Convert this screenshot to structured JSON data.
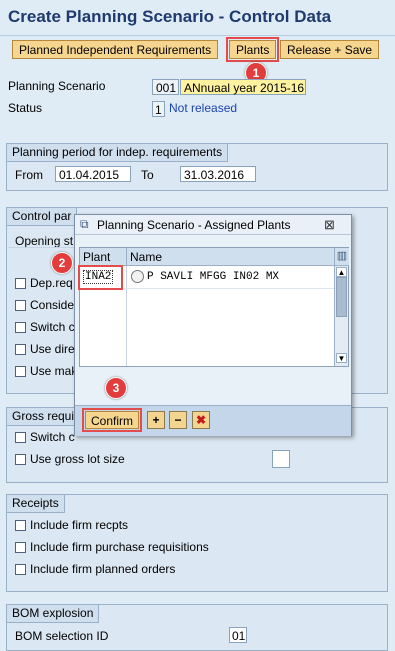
{
  "page": {
    "title": "Create Planning Scenario - Control Data"
  },
  "toolbar": {
    "planned_independent_requirements": "Planned Independent Requirements",
    "plants": "Plants",
    "release_save": "Release + Save"
  },
  "header_fields": {
    "planning_scenario_label": "Planning Scenario",
    "planning_scenario_code": "001",
    "planning_scenario_text": "ANnuaal year 2015-16",
    "status_label": "Status",
    "status_code": "1",
    "status_text": "Not released"
  },
  "planning_period": {
    "title": "Planning period for indep. requirements",
    "from_label": "From",
    "from_value": "01.04.2015",
    "to_label": "To",
    "to_value": "31.03.2016"
  },
  "control_parameters": {
    "title": "Control par",
    "opening_label": "Opening st",
    "items": [
      "Dep.req",
      "Conside",
      "Switch c",
      "Use dire",
      "Use mak"
    ]
  },
  "gross_requirements": {
    "title": "Gross requi",
    "items": [
      "Switch c",
      "Use gross lot size"
    ]
  },
  "receipts": {
    "title": "Receipts",
    "items": [
      "Include firm recpts",
      "Include firm purchase requisitions",
      "Include firm planned orders"
    ]
  },
  "bom_explosion": {
    "title": "BOM explosion",
    "selection_id_label": "BOM selection ID",
    "selection_id_value": "01"
  },
  "popup": {
    "title": "Planning Scenario - Assigned Plants",
    "columns": [
      "Plant",
      "Name"
    ],
    "rows": [
      {
        "plant": "INA2",
        "name": "P SAVLI MFGG IN02 MX"
      }
    ],
    "confirm_label": "Confirm",
    "close_glyph": "⊠"
  },
  "markers": [
    "1",
    "2",
    "3"
  ],
  "colors": {
    "marker": "#e33c3c",
    "title": "#1f3a6e",
    "button": "#f6d58f",
    "highlight": "#fff3a0"
  }
}
